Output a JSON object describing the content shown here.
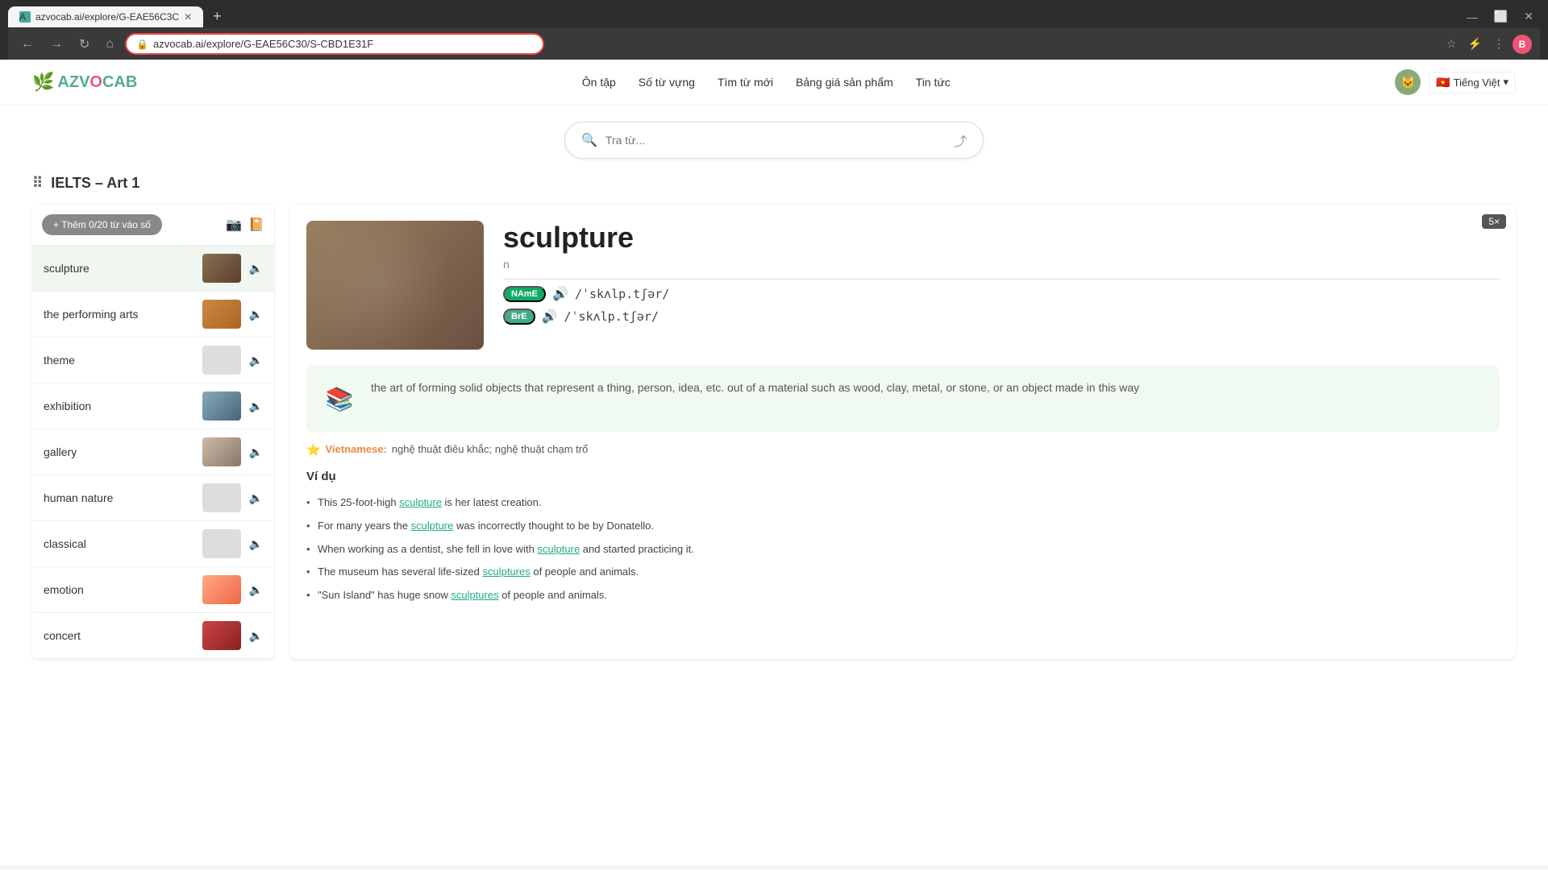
{
  "browser": {
    "tab_title": "azvocab.ai/explore/G-EAE56C3C",
    "tab_favicon": "A",
    "address": "azvocab.ai/explore/G-EAE56C30/S-CBD1E31F",
    "new_tab_label": "+"
  },
  "header": {
    "logo_text": "AZVOCAB",
    "nav": {
      "items": [
        {
          "label": "Ôn tập"
        },
        {
          "label": "Số từ vựng"
        },
        {
          "label": "Tìm từ mới"
        },
        {
          "label": "Bảng giá sản phẩm"
        },
        {
          "label": "Tin tức"
        }
      ]
    },
    "lang": "Tiếng Việt"
  },
  "search": {
    "placeholder": "Tra từ..."
  },
  "list_title": "IELTS – Art 1",
  "add_button": "+ Thêm 0/20 từ vào số",
  "words": [
    {
      "text": "sculpture",
      "has_image": true,
      "thumb_class": "thumb-sculpture"
    },
    {
      "text": "the performing arts",
      "has_image": true,
      "thumb_class": "thumb-performing"
    },
    {
      "text": "theme",
      "has_image": false,
      "thumb_class": ""
    },
    {
      "text": "exhibition",
      "has_image": true,
      "thumb_class": "thumb-exhibition"
    },
    {
      "text": "gallery",
      "has_image": true,
      "thumb_class": "thumb-gallery"
    },
    {
      "text": "human nature",
      "has_image": false,
      "thumb_class": ""
    },
    {
      "text": "classical",
      "has_image": false,
      "thumb_class": ""
    },
    {
      "text": "emotion",
      "has_image": true,
      "thumb_class": "thumb-emotion"
    },
    {
      "text": "concert",
      "has_image": true,
      "thumb_class": "thumb-concert"
    }
  ],
  "detail": {
    "word": "sculpture",
    "pos": "n",
    "corner_badge": "5×",
    "pronunciations": [
      {
        "badge": "NAmE",
        "badge_class": "name",
        "ipa": "/ˈskʌlp.tʃər/"
      },
      {
        "badge": "BrE",
        "badge_class": "bre",
        "ipa": "/ˈskʌlp.tʃər/"
      }
    ],
    "definition": "the art of forming solid objects that represent a thing, person, idea, etc. out of a material such as wood, clay, metal, or stone, or an object made in this way",
    "definition_icon": "📚",
    "vietnamese_label": "Vietnamese:",
    "vietnamese_text": "nghệ thuật điêu khắc; nghệ thuật chạm trổ",
    "example_title": "Ví dụ",
    "examples": [
      "This 25-foot-high sculpture is her latest creation.",
      "For many years the sculpture was incorrectly thought to be by Donatello.",
      "When working as a dentist, she fell in love with sculpture and started practicing it.",
      "The museum has several life-sized sculptures of people and animals.",
      "\"Sun Island\" has huge snow sculptures of people and animals."
    ],
    "highlight_word": "sculpture",
    "highlight_word_plural": "sculptures"
  }
}
